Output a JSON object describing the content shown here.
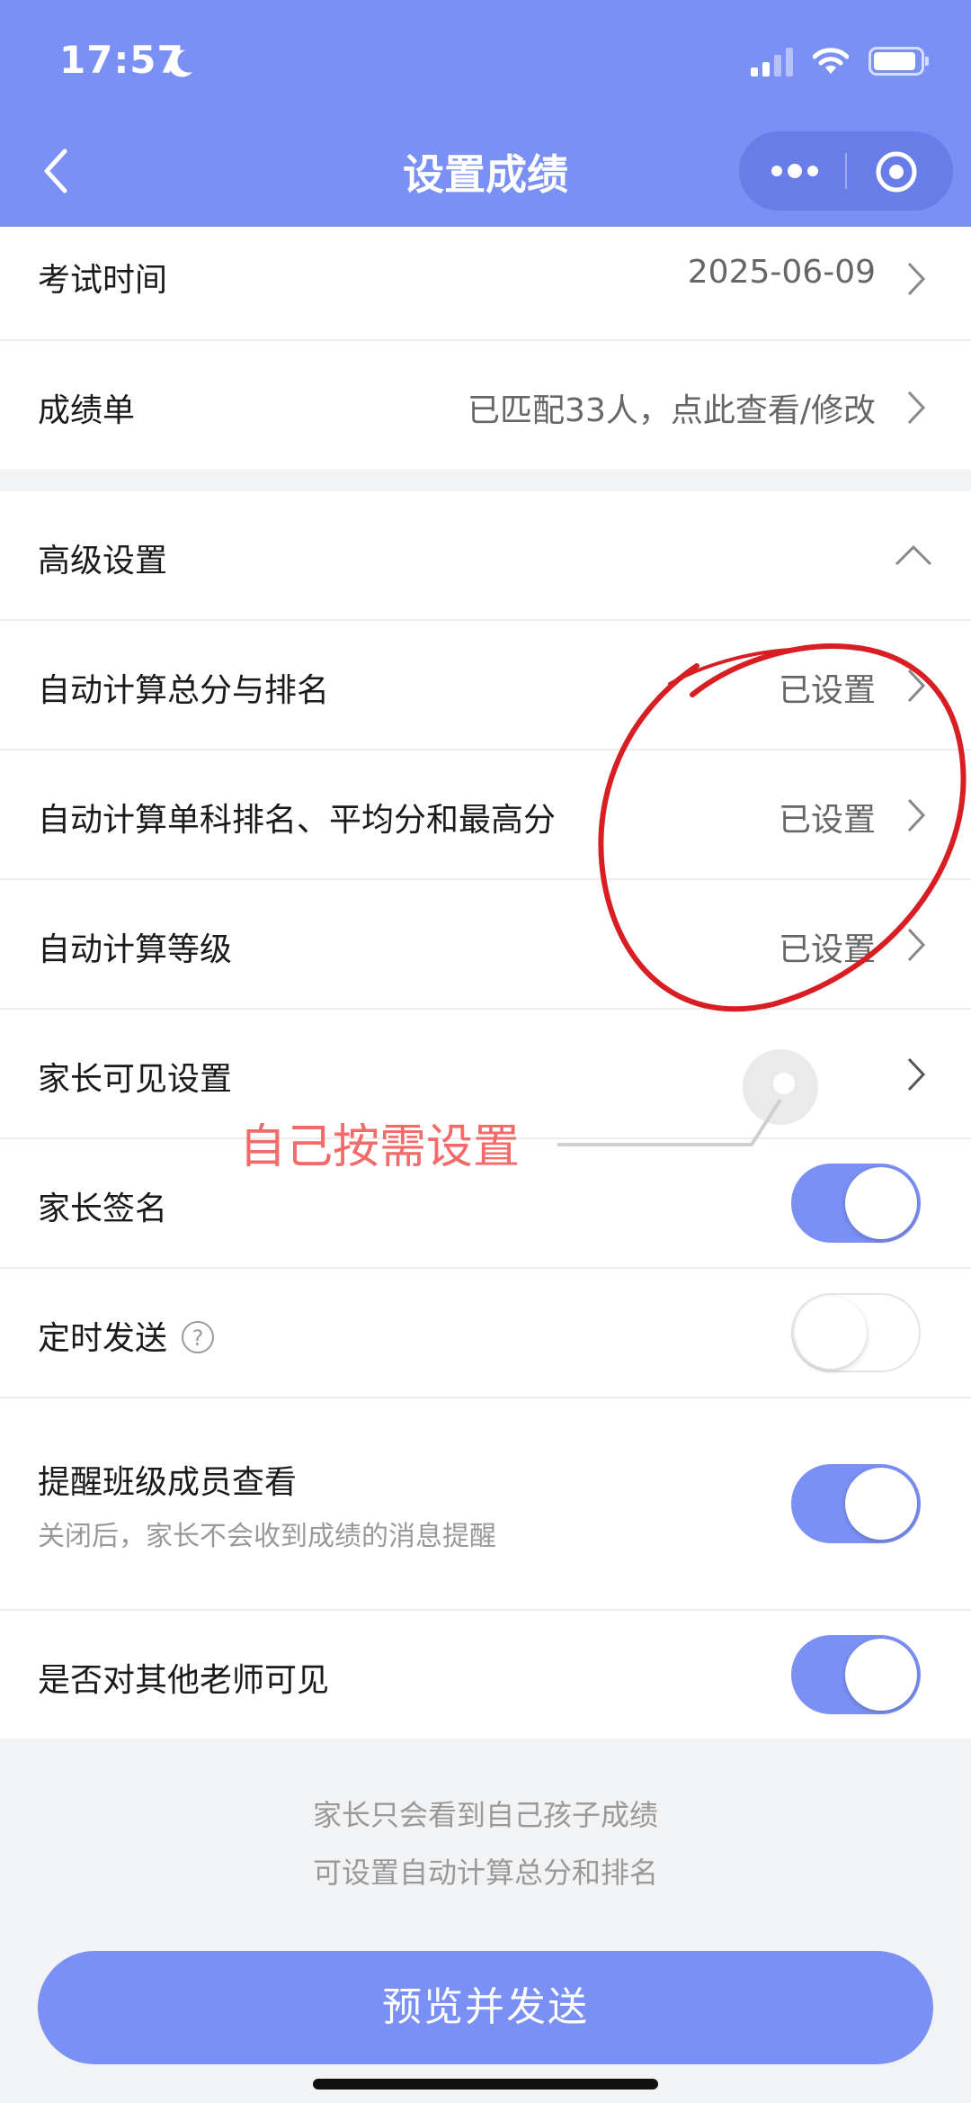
{
  "status_bar": {
    "time": "17:57"
  },
  "nav": {
    "title": "设置成绩"
  },
  "rows": {
    "exam_time": {
      "label": "考试时间",
      "value": "2025-06-09"
    },
    "score_sheet": {
      "label": "成绩单",
      "value": "已匹配33人，点此查看/修改"
    },
    "advanced": {
      "label": "高级设置"
    },
    "auto_total": {
      "label": "自动计算总分与排名",
      "value": "已设置"
    },
    "auto_single": {
      "label": "自动计算单科排名、平均分和最高分",
      "value": "已设置"
    },
    "auto_grade": {
      "label": "自动计算等级",
      "value": "已设置"
    },
    "parent_visible": {
      "label": "家长可见设置"
    },
    "parent_sign": {
      "label": "家长签名",
      "on": true
    },
    "scheduled_send": {
      "label": "定时发送",
      "help": "?",
      "on": false
    },
    "remind_members": {
      "label": "提醒班级成员查看",
      "sub": "关闭后，家长不会收到成绩的消息提醒",
      "on": true
    },
    "visible_teachers": {
      "label": "是否对其他老师可见",
      "on": true
    }
  },
  "footer": {
    "note_line1": "家长只会看到自己孩子成绩",
    "note_line2": "可设置自动计算总分和排名",
    "send_label": "预览并发送"
  },
  "annotation": {
    "text": "自己按需设置",
    "color": "#d81e22"
  },
  "colors": {
    "accent": "#7b90f5"
  }
}
